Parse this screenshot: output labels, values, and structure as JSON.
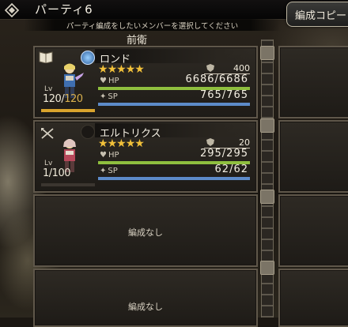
{
  "header": {
    "party_title": "パーティ6",
    "instruction": "パーティ編成をしたいメンバーを選択してください",
    "formation_button": "編成コピー"
  },
  "section_label": "前衛",
  "members": [
    {
      "name": "ロンド",
      "stars": 5,
      "max_stars": 5,
      "lv_label": "Lv",
      "level": "120",
      "level_max": "120",
      "level_fill": 1.0,
      "guard": "400",
      "hp_label": "HP",
      "hp": "6686/6686",
      "hp_fill": 1.0,
      "sp_label": "SP",
      "sp": "765/765",
      "sp_fill": 1.0
    },
    {
      "name": "エルトリクス",
      "stars": 5,
      "max_stars": 5,
      "lv_label": "Lv",
      "level": "1",
      "level_max": "100",
      "level_fill": 0.0,
      "guard": "20",
      "hp_label": "HP",
      "hp": "295/295",
      "hp_fill": 1.0,
      "sp_label": "SP",
      "sp": "62/62",
      "sp_fill": 1.0
    }
  ],
  "empty_slots": [
    {
      "label": "編成なし"
    },
    {
      "label": "編成なし"
    }
  ],
  "colors": {
    "star": "#f2c13a",
    "hp_bar": "#8fbf3e",
    "sp_bar": "#5d8bc9",
    "level_bar": "#d9a32d"
  }
}
